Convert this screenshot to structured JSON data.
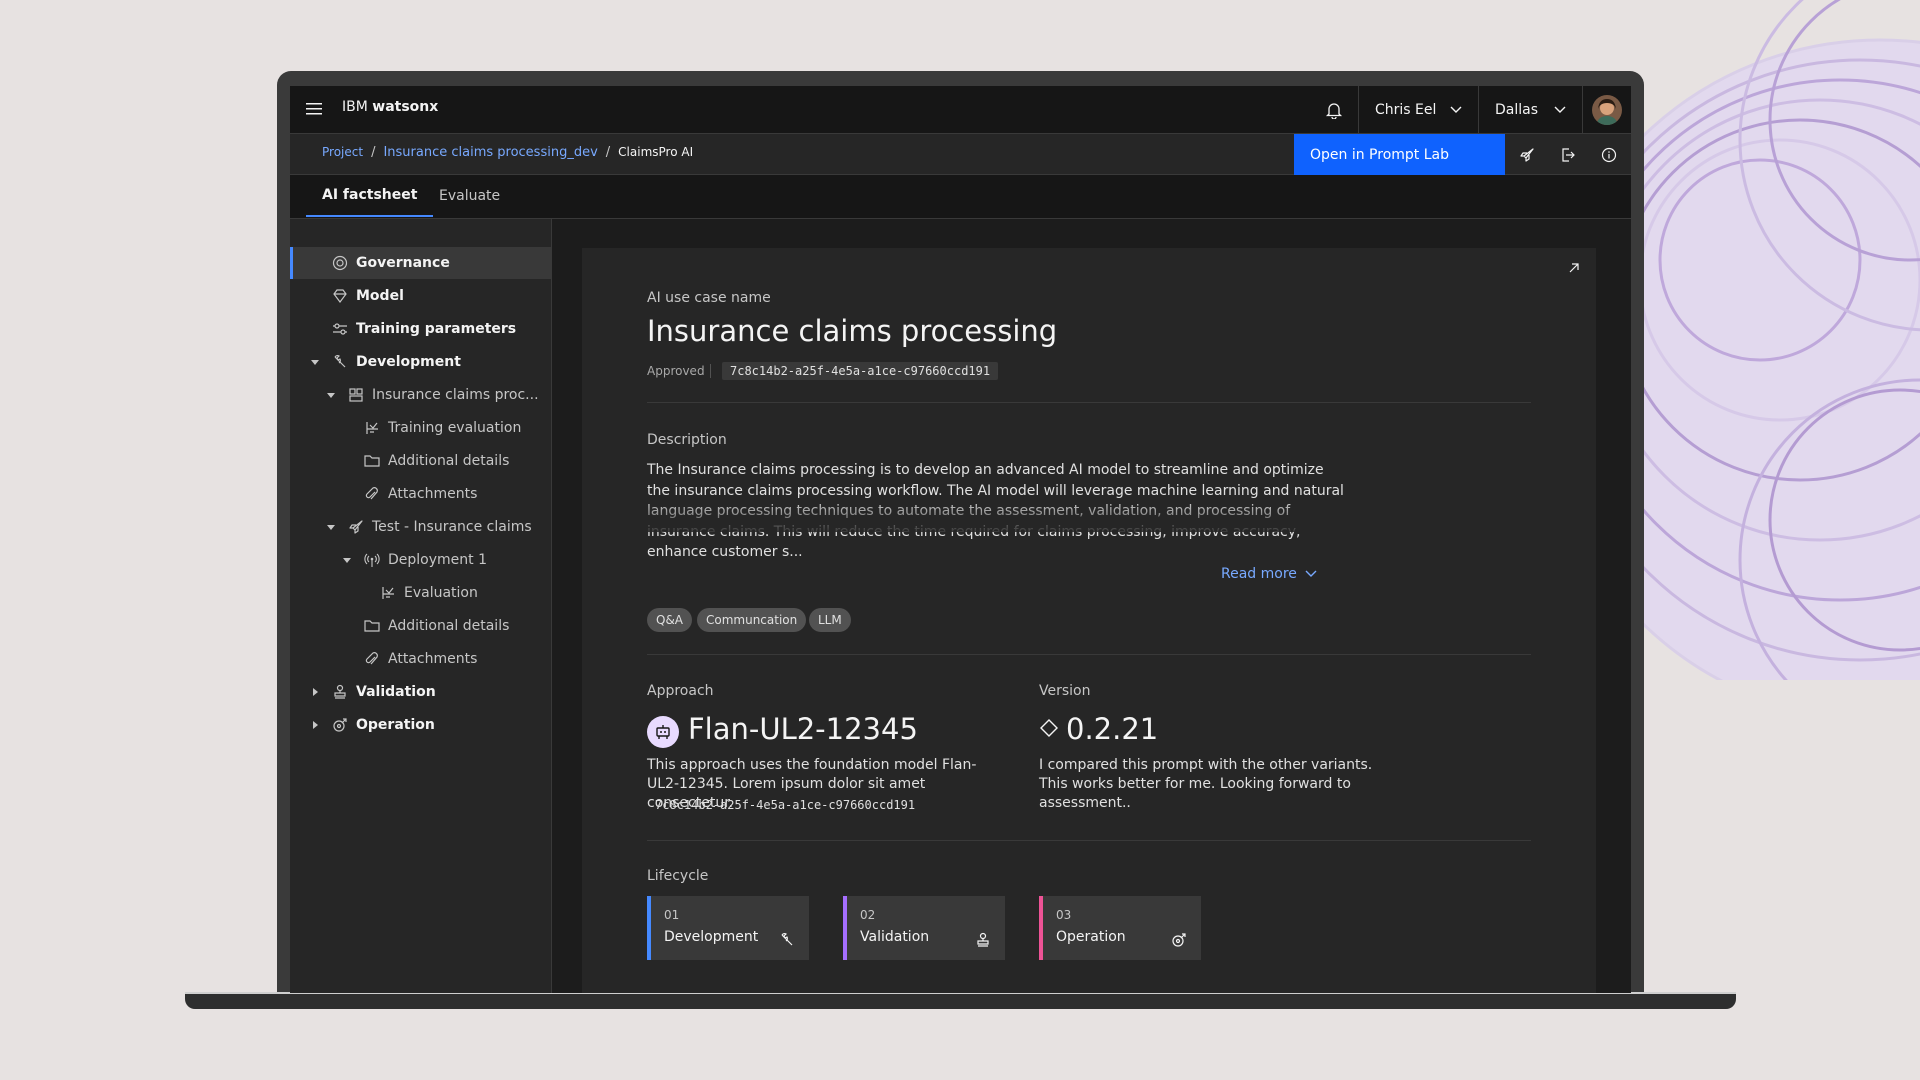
{
  "header": {
    "brand_prefix": "IBM",
    "brand_product": "watsonx",
    "user_name": "Chris Eel",
    "region": "Dallas"
  },
  "breadcrumb": {
    "items": [
      "Project",
      "Insurance claims processing_dev"
    ],
    "current": "ClaimsPro AI",
    "separator": "/"
  },
  "actions": {
    "open_prompt_lab": "Open in Prompt Lab"
  },
  "tabs": [
    {
      "label": "AI factsheet",
      "active": true
    },
    {
      "label": "Evaluate",
      "active": false
    }
  ],
  "sidebar": {
    "items": [
      {
        "label": "Governance",
        "icon": "governance-icon",
        "selected": true
      },
      {
        "label": "Model",
        "icon": "diamond-model-icon"
      },
      {
        "label": "Training parameters",
        "icon": "sliders-icon"
      },
      {
        "label": "Development",
        "icon": "wrench-icon",
        "expanded": true
      },
      {
        "label": "Insurance claims proc...",
        "icon": "grid-icon",
        "expanded": true
      },
      {
        "label": "Training evaluation",
        "icon": "chart-evaluation-icon"
      },
      {
        "label": "Additional details",
        "icon": "folder-icon"
      },
      {
        "label": "Attachments",
        "icon": "paperclip-icon"
      },
      {
        "label": "Test - Insurance claims",
        "icon": "rocket-icon",
        "expanded": true
      },
      {
        "label": "Deployment 1",
        "icon": "antenna-icon",
        "expanded": true
      },
      {
        "label": "Evaluation",
        "icon": "chart-evaluation-icon"
      },
      {
        "label": "Additional details",
        "icon": "folder-icon"
      },
      {
        "label": "Attachments",
        "icon": "paperclip-icon"
      },
      {
        "label": "Validation",
        "icon": "stamp-icon",
        "expanded": false
      },
      {
        "label": "Operation",
        "icon": "operation-icon",
        "expanded": false
      }
    ]
  },
  "factsheet": {
    "use_case_label": "AI use case name",
    "title": "Insurance claims processing",
    "status": "Approved",
    "id": "7c8c14b2-a25f-4e5a-a1ce-c97660ccd191",
    "description_label": "Description",
    "description": "The Insurance claims processing is to develop an advanced AI model to streamline and optimize the insurance claims processing workflow. The AI model will leverage machine learning and natural language processing techniques to automate the assessment, validation, and processing of insurance claims. This will reduce the time required for claims processing, improve accuracy, enhance customer s...",
    "read_more": "Read more",
    "tags": [
      "Q&A",
      "Communcation",
      "LLM"
    ],
    "approach": {
      "label": "Approach",
      "name": "Flan-UL2-12345",
      "description": "This approach uses the foundation model Flan-UL2-12345. Lorem ipsum dolor sit amet consectetur.",
      "id": "7c8c14b2-a25f-4e5a-a1ce-c97660ccd191"
    },
    "version": {
      "label": "Version",
      "number": "0.2.21",
      "note": "I compared this prompt with the other variants. This works better for me. Looking forward to assessment.."
    },
    "lifecycle": {
      "label": "Lifecycle",
      "stages": [
        {
          "num": "01",
          "name": "Development",
          "color": "#4589ff",
          "icon": "wrench-icon"
        },
        {
          "num": "02",
          "name": "Validation",
          "color": "#a56eff",
          "icon": "stamp-icon"
        },
        {
          "num": "03",
          "name": "Operation",
          "color": "#ee5396",
          "icon": "operation-icon"
        }
      ]
    }
  },
  "colors": {
    "accent": "#0f62fe",
    "link": "#78a9ff",
    "background": "#161616"
  }
}
